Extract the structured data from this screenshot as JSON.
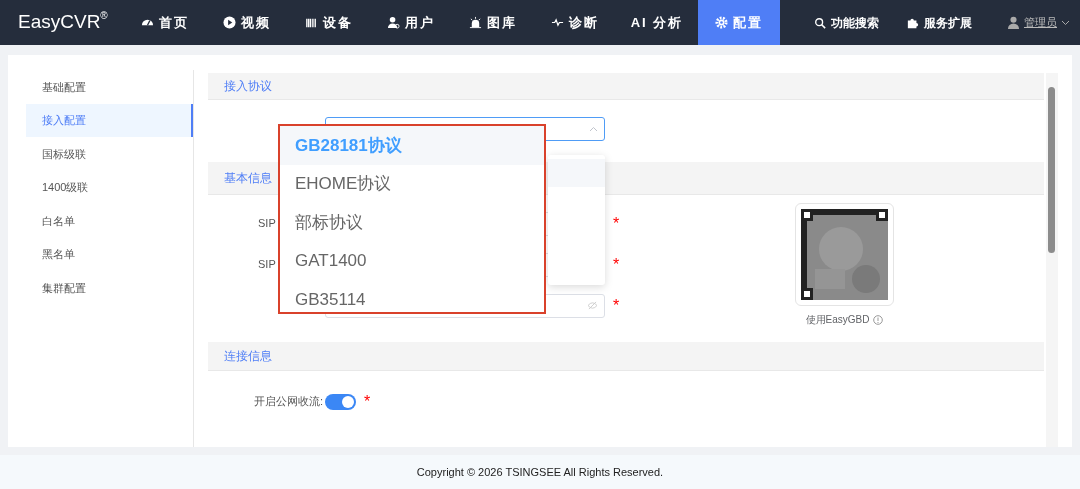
{
  "navbar": {
    "logo": "EasyCVR",
    "logo_mark": "®",
    "items": [
      {
        "label": "首页",
        "selected": false
      },
      {
        "label": "视频",
        "selected": false
      },
      {
        "label": "设备",
        "selected": false
      },
      {
        "label": "用户",
        "selected": false
      },
      {
        "label": "图库",
        "selected": false
      },
      {
        "label": "诊断",
        "selected": false
      },
      {
        "label": "AI 分析",
        "selected": false
      },
      {
        "label": "配置",
        "selected": true
      }
    ],
    "right_items": [
      "功能搜索",
      "服务扩展"
    ],
    "user": "管理员"
  },
  "sidebar": {
    "items": [
      {
        "label": "基础配置",
        "selected": false
      },
      {
        "label": "接入配置",
        "selected": true
      },
      {
        "label": "国标级联",
        "selected": false
      },
      {
        "label": "1400级联",
        "selected": false
      },
      {
        "label": "白名单",
        "selected": false
      },
      {
        "label": "黑名单",
        "selected": false
      },
      {
        "label": "集群配置",
        "selected": false
      }
    ]
  },
  "protocol_section": {
    "title": "接入协议",
    "select": {
      "expanded": true
    }
  },
  "basic_section": {
    "title": "基本信息",
    "fields": [
      {
        "label": "SIP",
        "kind": "text",
        "required_mark": "*"
      },
      {
        "label": "SIP",
        "kind": "text",
        "required_mark": "*"
      },
      {
        "kind": "password",
        "required_mark": "*"
      }
    ],
    "qr_caption": "使用EasyGBD"
  },
  "connection_section": {
    "title": "连接信息",
    "fields": [
      {
        "label": "开启公网收流:",
        "kind": "switch",
        "on": true,
        "required_mark": "*"
      }
    ]
  },
  "dropdown_options": [
    {
      "label": "GB28181协议",
      "selected": true
    },
    {
      "label": "EHOME协议",
      "selected": false
    },
    {
      "label": "部标协议",
      "selected": false
    },
    {
      "label": "GAT1400",
      "selected": false
    },
    {
      "label": "GB35114",
      "selected": false
    }
  ],
  "footer": "Copyright © 2026 TSINGSEE All Rights Reserved."
}
